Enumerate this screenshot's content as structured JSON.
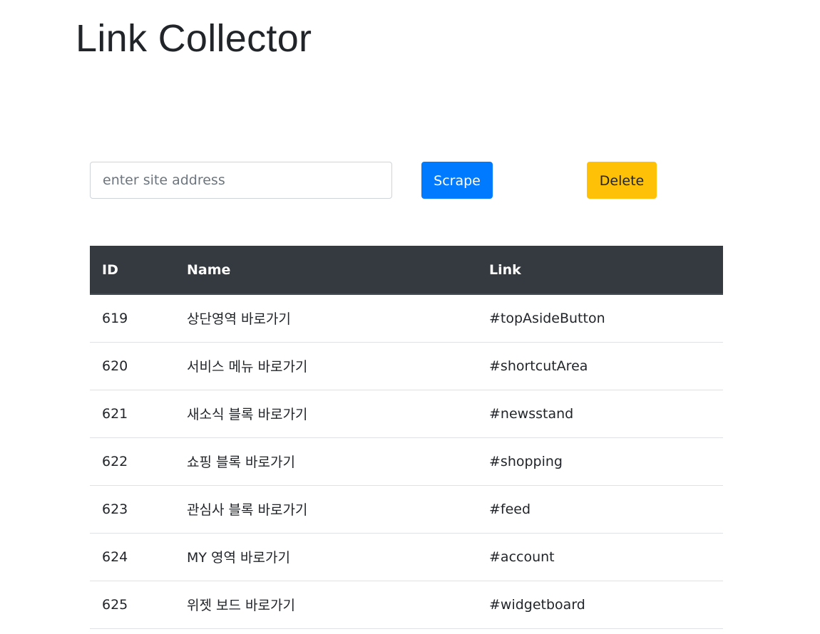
{
  "page": {
    "title": "Link Collector"
  },
  "controls": {
    "site_input_placeholder": "enter site address",
    "site_input_value": "",
    "scrape_label": "Scrape",
    "delete_label": "Delete"
  },
  "colors": {
    "scrape_button": "#007bff",
    "delete_button": "#ffc107",
    "table_header": "#343a40"
  },
  "table": {
    "headers": [
      "ID",
      "Name",
      "Link"
    ],
    "rows": [
      {
        "id": "619",
        "name": "상단영역 바로가기",
        "link": "#topAsideButton"
      },
      {
        "id": "620",
        "name": "서비스 메뉴 바로가기",
        "link": "#shortcutArea"
      },
      {
        "id": "621",
        "name": "새소식 블록 바로가기",
        "link": "#newsstand"
      },
      {
        "id": "622",
        "name": "쇼핑 블록 바로가기",
        "link": "#shopping"
      },
      {
        "id": "623",
        "name": "관심사 블록 바로가기",
        "link": "#feed"
      },
      {
        "id": "624",
        "name": "MY 영역 바로가기",
        "link": "#account"
      },
      {
        "id": "625",
        "name": "위젯 보드 바로가기",
        "link": "#widgetboard"
      }
    ]
  }
}
